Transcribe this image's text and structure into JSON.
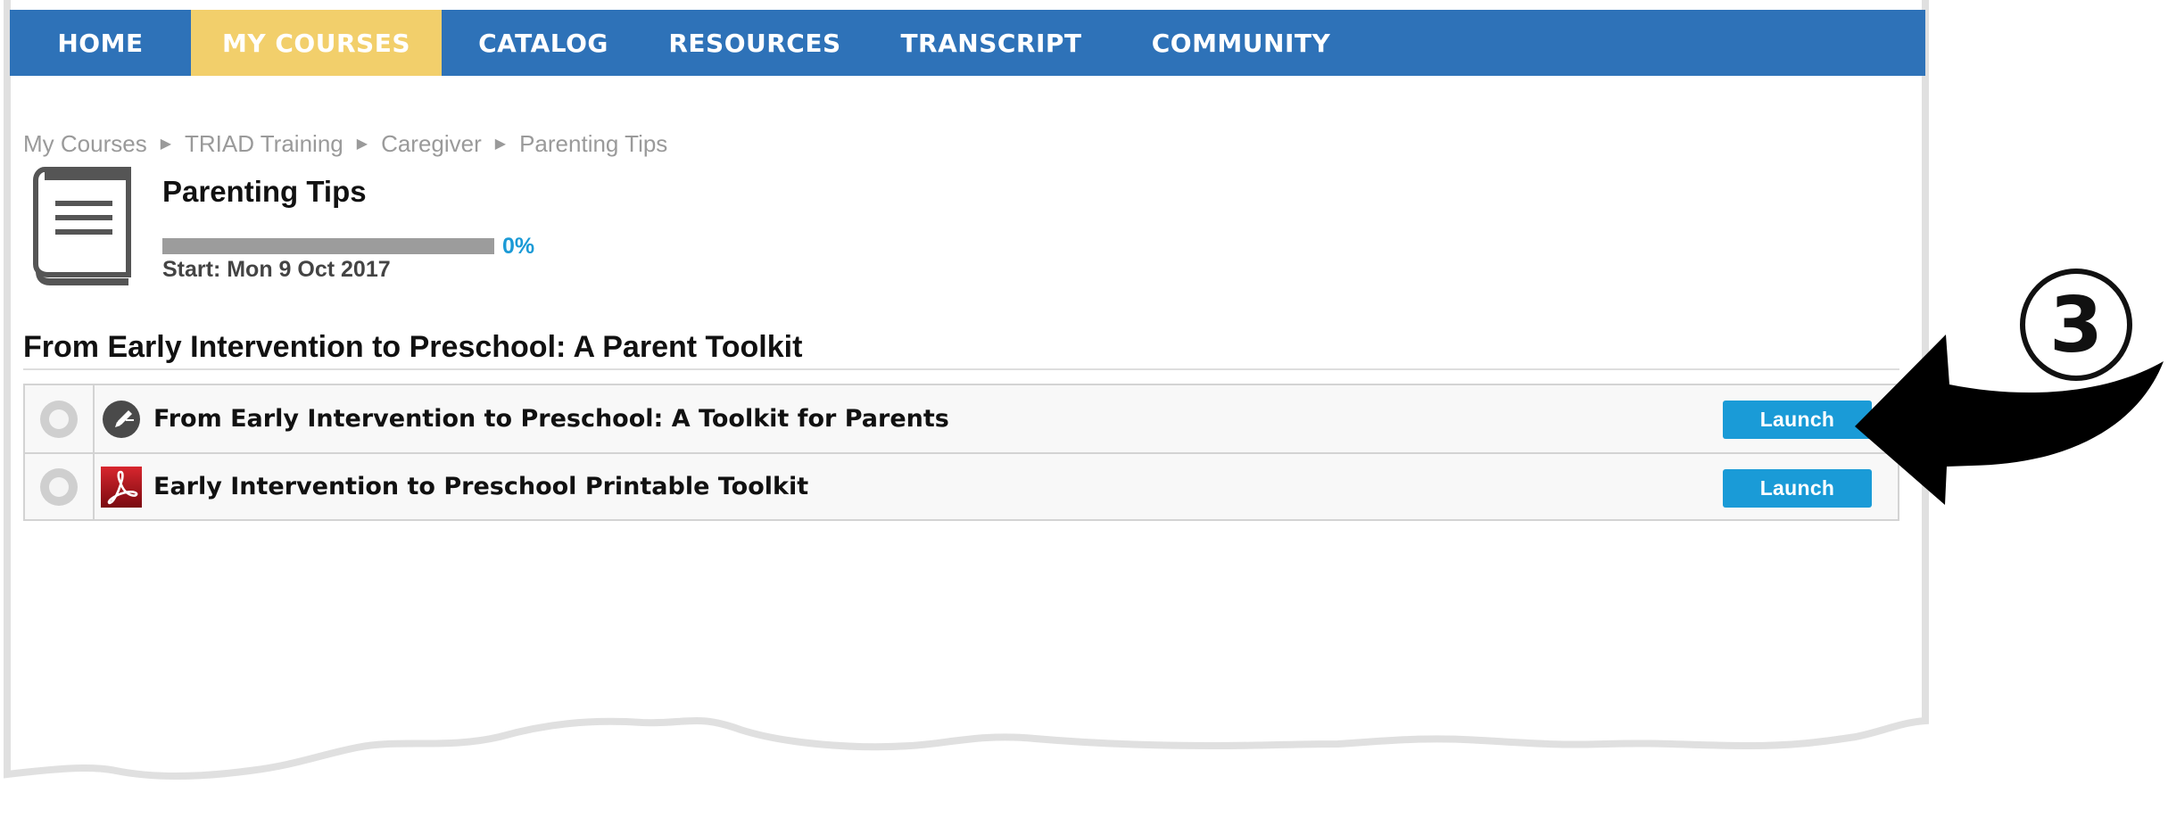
{
  "nav": {
    "items": [
      {
        "label": "HOME",
        "active": false
      },
      {
        "label": "MY COURSES",
        "active": true
      },
      {
        "label": "CATALOG",
        "active": false
      },
      {
        "label": "RESOURCES",
        "active": false
      },
      {
        "label": "TRANSCRIPT",
        "active": false
      },
      {
        "label": "COMMUNITY",
        "active": false
      }
    ],
    "colors": {
      "bar": "#2e72b8",
      "active": "#f2cf6b"
    }
  },
  "breadcrumb": [
    "My Courses",
    "TRIAD Training",
    "Caregiver",
    "Parenting Tips"
  ],
  "course": {
    "icon": "book-icon",
    "title": "Parenting Tips",
    "progress_fraction": 0,
    "progress_label": "0%",
    "start_label": "Start: Mon 9 Oct 2017"
  },
  "section": {
    "heading": "From Early Intervention to Preschool: A Parent Toolkit",
    "items": [
      {
        "title": "From Early Intervention to Preschool: A Toolkit for Parents",
        "icon": "external-link-pencil-icon",
        "action": "Launch"
      },
      {
        "title": "Early Intervention to Preschool Printable Toolkit",
        "icon": "pdf-icon",
        "action": "Launch"
      }
    ]
  },
  "annotation": {
    "step_marker": "③",
    "icon": "pointer-arrow-icon"
  },
  "colors": {
    "launch_button": "#1a9bd7",
    "progress_pct": "#1b9ad6"
  }
}
